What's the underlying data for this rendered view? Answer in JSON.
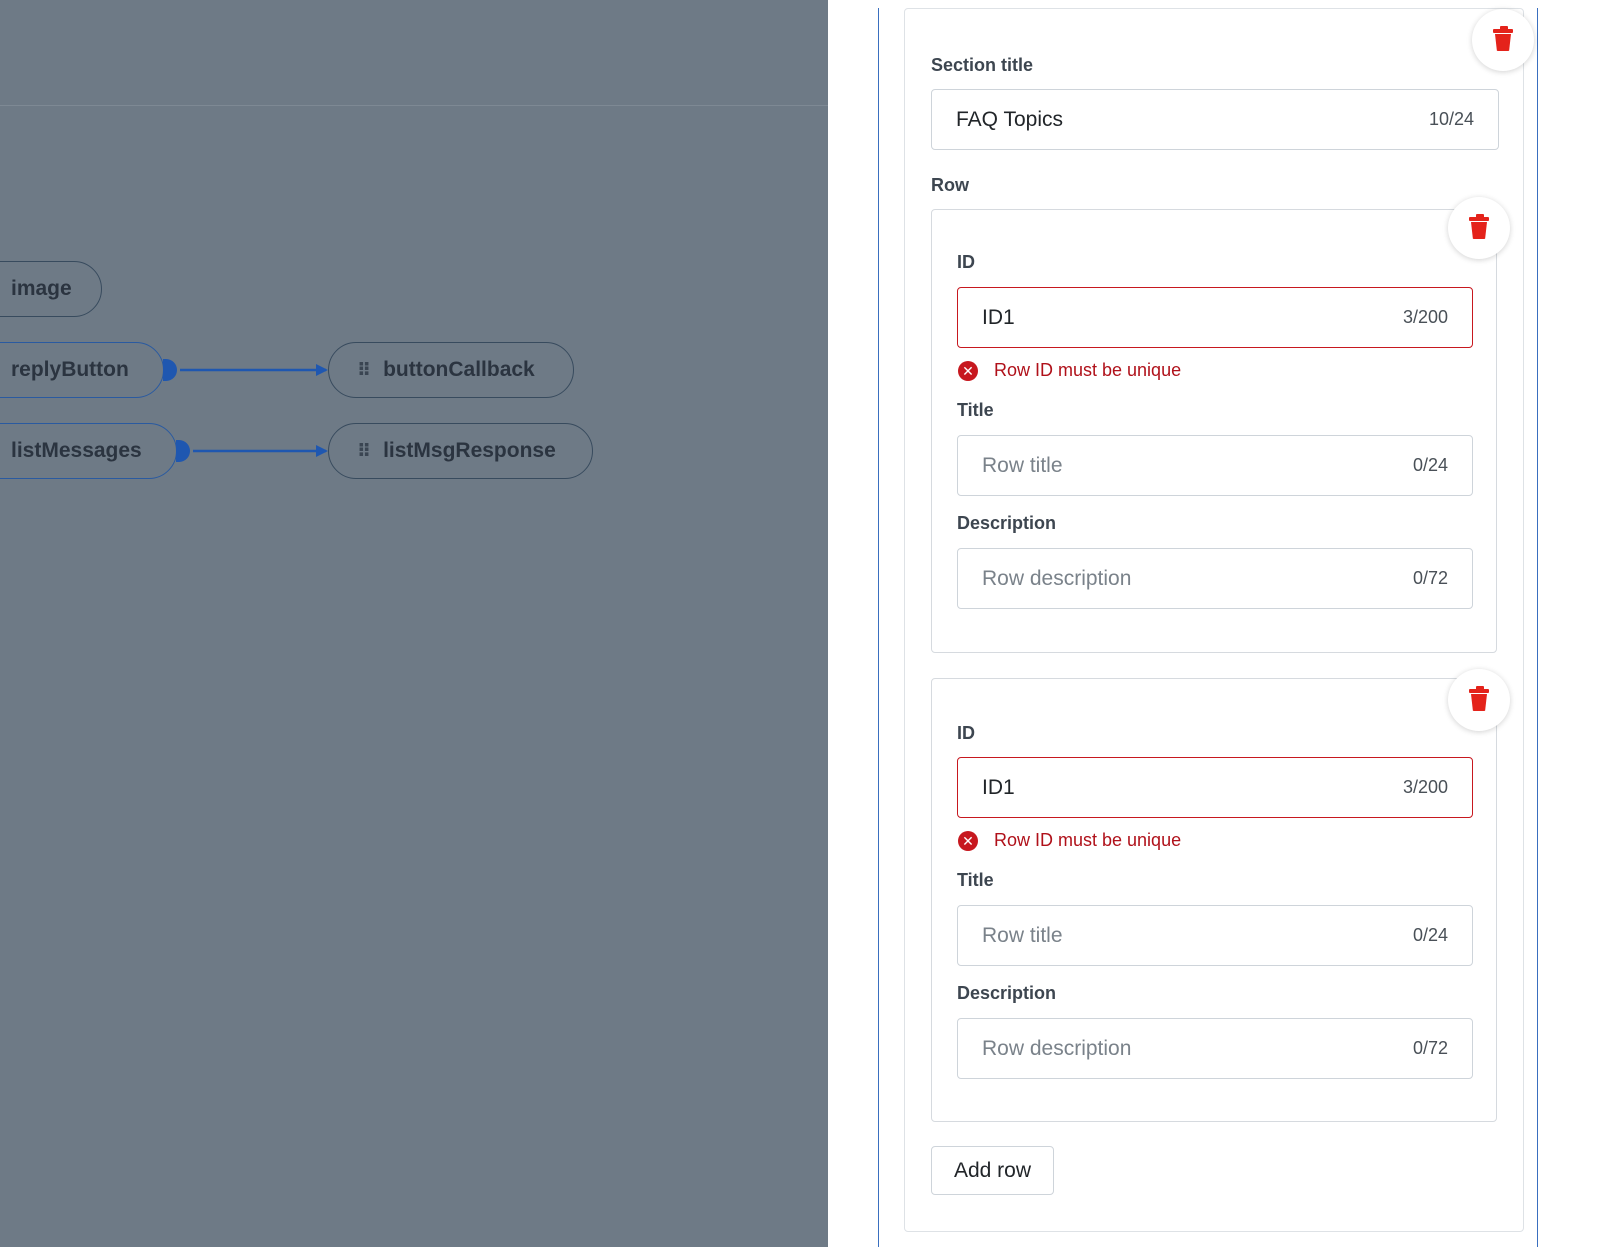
{
  "canvas": {
    "nodes": {
      "image": "image",
      "reply_button": "replyButton",
      "button_callback": "buttonCallback",
      "list_messages": "listMessages",
      "list_msg_response": "listMsgResponse"
    },
    "colors": {
      "background": "#6e7a86",
      "edge": "#1f57b0"
    }
  },
  "panel": {
    "section_title_label": "Section title",
    "section_title_value": "FAQ Topics",
    "section_title_counter": "10/24",
    "row_label": "Row",
    "rows": [
      {
        "id_label": "ID",
        "id_value": "ID1",
        "id_counter": "3/200",
        "id_error": "Row ID must be unique",
        "title_label": "Title",
        "title_placeholder": "Row title",
        "title_counter": "0/24",
        "description_label": "Description",
        "description_placeholder": "Row description",
        "description_counter": "0/72"
      },
      {
        "id_label": "ID",
        "id_value": "ID1",
        "id_counter": "3/200",
        "id_error": "Row ID must be unique",
        "title_label": "Title",
        "title_placeholder": "Row title",
        "title_counter": "0/24",
        "description_label": "Description",
        "description_placeholder": "Row description",
        "description_counter": "0/72"
      }
    ],
    "add_row_label": "Add row",
    "icons": {
      "delete": "trash-icon",
      "error": "error-circle-icon",
      "drag": "drag-handle-icon"
    },
    "colors": {
      "error": "#c7181f",
      "delete": "#e4231b",
      "border_accent": "#3a6fbf"
    }
  }
}
